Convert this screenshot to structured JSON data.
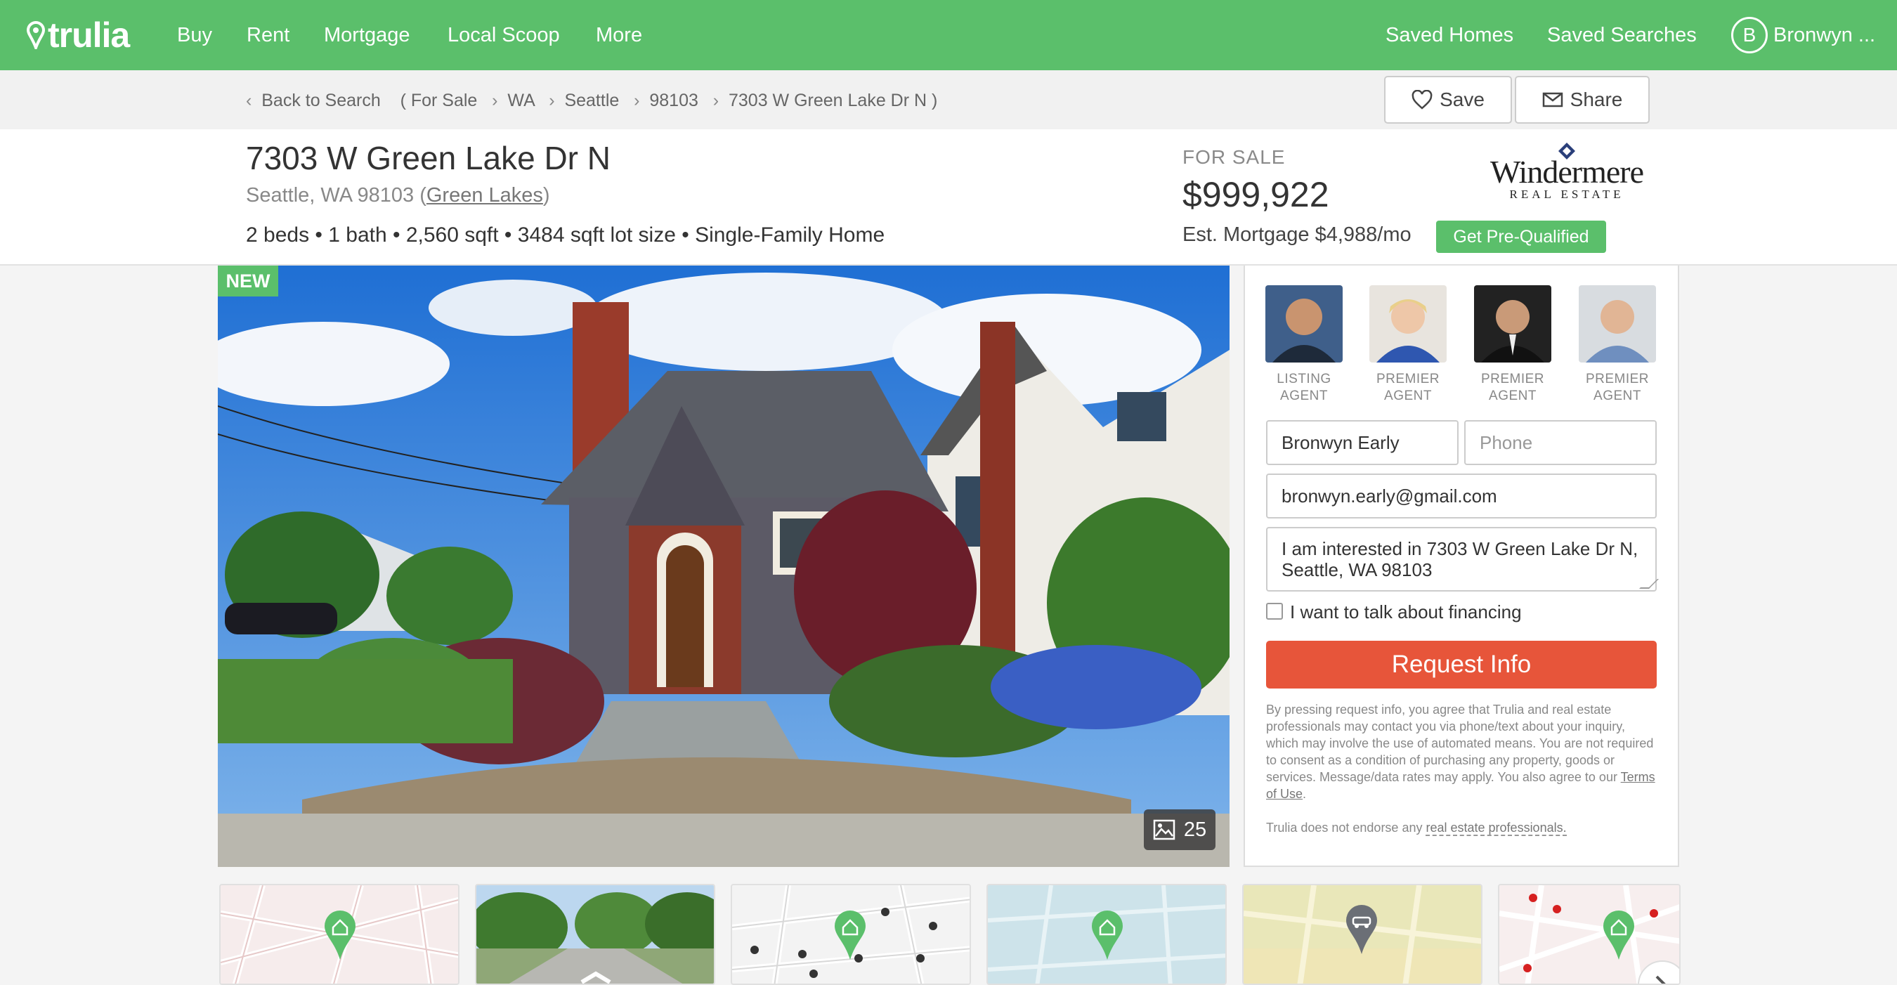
{
  "nav": {
    "logo": "trulia",
    "links": [
      "Buy",
      "Rent",
      "Mortgage",
      "Local Scoop",
      "More"
    ],
    "saved_homes": "Saved Homes",
    "saved_searches": "Saved Searches",
    "user_initial": "B",
    "user_name": "Bronwyn ..."
  },
  "breadcrumb": {
    "back": "Back to Search",
    "open_paren": "( For Sale",
    "state": "WA",
    "city": "Seattle",
    "zip": "98103",
    "address": "7303 W Green Lake Dr N )"
  },
  "actions": {
    "save": "Save",
    "share": "Share"
  },
  "listing": {
    "address": "7303 W Green Lake Dr N",
    "city_line": "Seattle, WA 98103",
    "neighborhood": "Green Lakes",
    "facts": "2 beds • 1 bath • 2,560 sqft • 3484 sqft lot size • Single-Family Home",
    "status": "FOR SALE",
    "price": "$999,922",
    "mortgage": "Est. Mortgage $4,988/mo",
    "prequal": "Get Pre-Qualified",
    "broker_name": "Windermere",
    "broker_sub": "REAL ESTATE"
  },
  "photo": {
    "badge": "NEW",
    "count": "25"
  },
  "agents": [
    {
      "line1": "LISTING",
      "line2": "AGENT"
    },
    {
      "line1": "PREMIER",
      "line2": "AGENT"
    },
    {
      "line1": "PREMIER",
      "line2": "AGENT"
    },
    {
      "line1": "PREMIER",
      "line2": "AGENT"
    }
  ],
  "form": {
    "name_value": "Bronwyn Early",
    "phone_placeholder": "Phone",
    "email_value": "bronwyn.early@gmail.com",
    "message_value": "I am interested in 7303 W Green Lake Dr N, Seattle, WA 98103",
    "financing_label": "I want to talk about financing",
    "submit": "Request Info",
    "disclaimer": "By pressing request info, you agree that Trulia and real estate professionals may contact you via phone/text about your inquiry, which may involve the use of automated means. You are not required to consent as a condition of purchasing any property, goods or services. Message/data rates may apply. You also agree to our",
    "terms_link": "Terms of Use",
    "no_endorse": "Trulia does not endorse any",
    "no_endorse_link": "real estate professionals."
  },
  "colors": {
    "brand_green": "#5bbf6b",
    "cta_red": "#e7553a"
  }
}
